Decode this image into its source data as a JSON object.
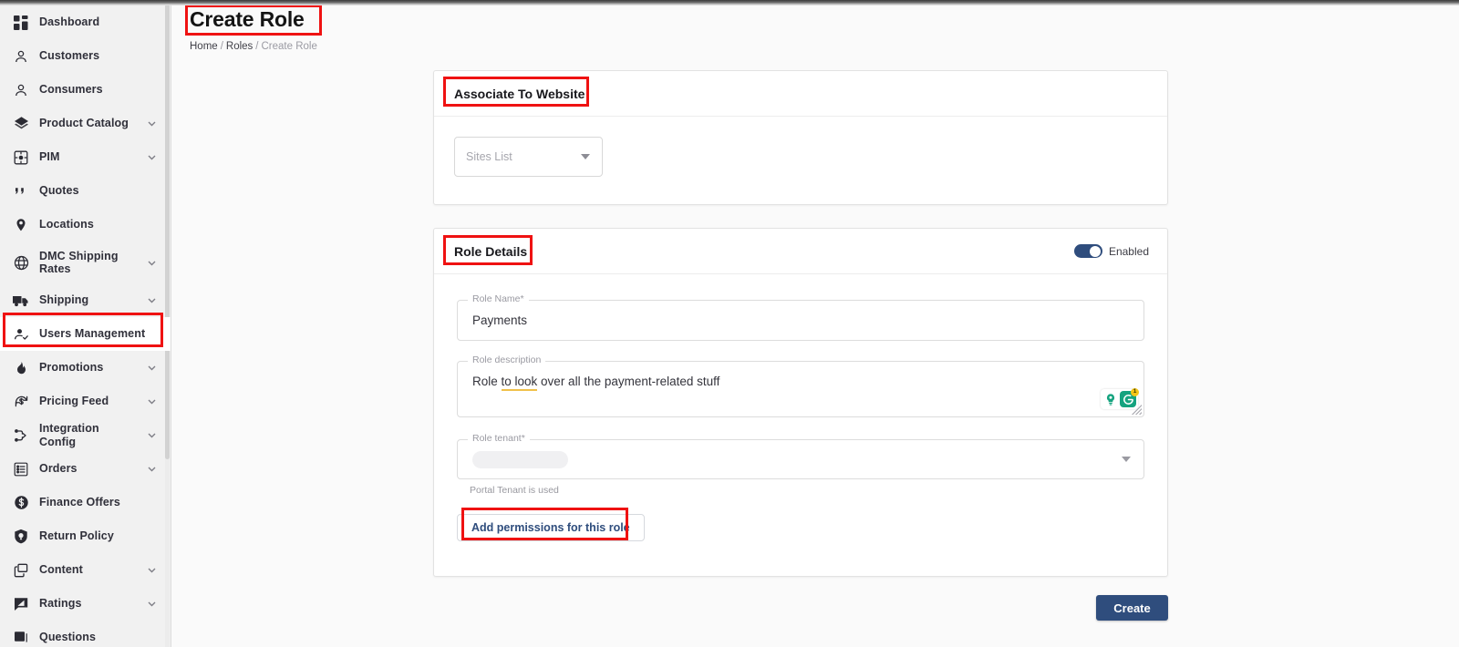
{
  "sidebar": {
    "items": [
      {
        "label": "Dashboard",
        "icon": "dashboard-icon",
        "expandable": false,
        "active": false
      },
      {
        "label": "Customers",
        "icon": "user-icon",
        "expandable": false,
        "active": false
      },
      {
        "label": "Consumers",
        "icon": "user-icon",
        "expandable": false,
        "active": false
      },
      {
        "label": "Product Catalog",
        "icon": "layers-icon",
        "expandable": true,
        "active": false
      },
      {
        "label": "PIM",
        "icon": "puzzle-icon",
        "expandable": true,
        "active": false
      },
      {
        "label": "Quotes",
        "icon": "quote-icon",
        "expandable": false,
        "active": false
      },
      {
        "label": "Locations",
        "icon": "map-pin-icon",
        "expandable": false,
        "active": false
      },
      {
        "label": "DMC Shipping Rates",
        "icon": "globe-icon",
        "expandable": true,
        "active": false
      },
      {
        "label": "Shipping",
        "icon": "truck-icon",
        "expandable": true,
        "active": false
      },
      {
        "label": "Users Management",
        "icon": "user-check-icon",
        "expandable": false,
        "active": true
      },
      {
        "label": "Promotions",
        "icon": "flame-icon",
        "expandable": true,
        "active": false
      },
      {
        "label": "Pricing Feed",
        "icon": "price-refresh-icon",
        "expandable": true,
        "active": false
      },
      {
        "label": "Integration Config",
        "icon": "integration-icon",
        "expandable": true,
        "active": false
      },
      {
        "label": "Orders",
        "icon": "list-icon",
        "expandable": true,
        "active": false
      },
      {
        "label": "Finance Offers",
        "icon": "dollar-circle-icon",
        "expandable": false,
        "active": false
      },
      {
        "label": "Return Policy",
        "icon": "shield-icon",
        "expandable": false,
        "active": false
      },
      {
        "label": "Content",
        "icon": "copy-icon",
        "expandable": true,
        "active": false
      },
      {
        "label": "Ratings",
        "icon": "rating-icon",
        "expandable": true,
        "active": false
      },
      {
        "label": "Questions",
        "icon": "question-board-icon",
        "expandable": false,
        "active": false
      }
    ]
  },
  "header": {
    "title": "Create Role",
    "breadcrumb": {
      "home": "Home",
      "roles": "Roles",
      "current": "Create Role",
      "separator": "/"
    }
  },
  "associate_card": {
    "title": "Associate To Website",
    "sites_select": {
      "placeholder": "Sites List",
      "value": ""
    }
  },
  "role_details": {
    "title": "Role Details",
    "enabled_toggle": {
      "label": "Enabled",
      "state": "on"
    },
    "role_name": {
      "label": "Role Name",
      "required": "*",
      "value": "Payments"
    },
    "role_description": {
      "label": "Role description",
      "value_before": "Role ",
      "value_underlined": "to look",
      "value_after": " over all the payment-related stuff"
    },
    "role_tenant": {
      "label": "Role tenant",
      "required": "*",
      "value": "",
      "helper_text": "Portal Tenant is used"
    },
    "add_permissions_button": "Add permissions for this role",
    "grammarly": {
      "badge_count": "1"
    }
  },
  "footer": {
    "create_button": "Create"
  },
  "colors": {
    "accent": "#2f4d7d",
    "annotation": "#ef1212",
    "sidebar_bg": "#f1f1f1",
    "page_bg": "#fafafa",
    "grammarly_green": "#15a37f",
    "underline_yellow": "#f0c14b"
  }
}
